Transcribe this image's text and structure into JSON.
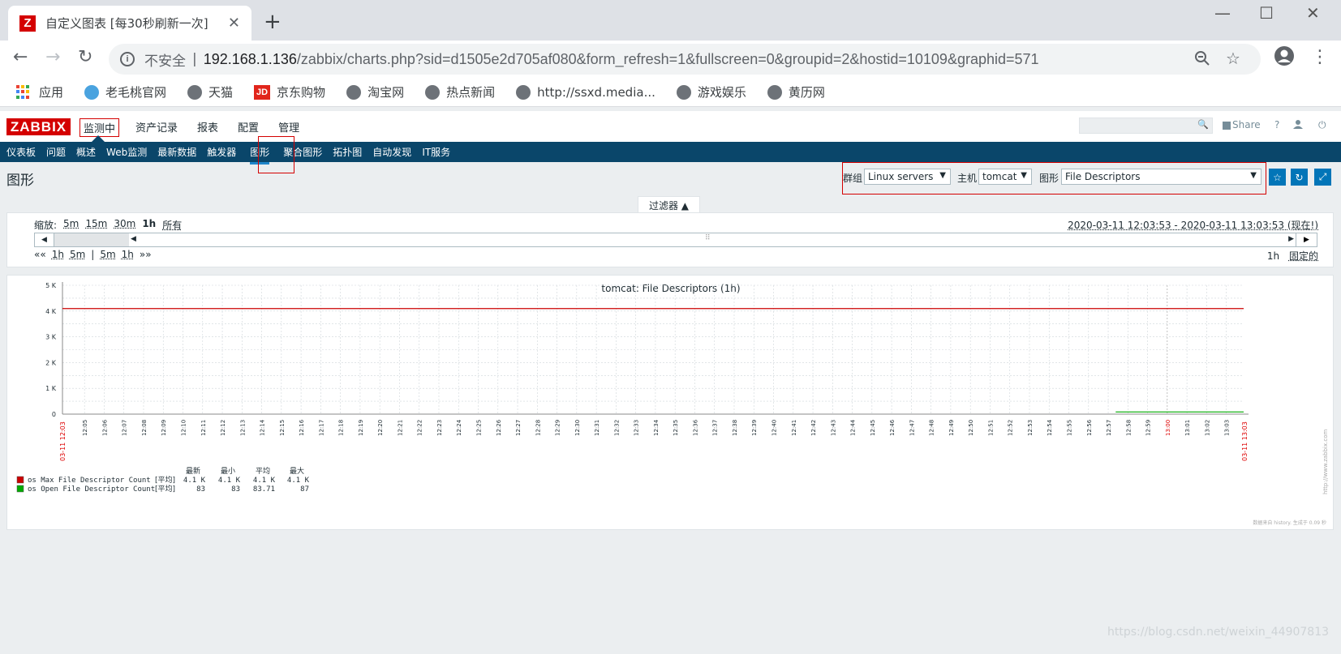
{
  "browser": {
    "tab_title": "自定义图表 [每30秒刷新一次]",
    "tab_favicon": "Z",
    "insecure_label": "不安全",
    "url_host": "192.168.1.136",
    "url_path": "/zabbix/charts.php?sid=d1505e2d705af080&form_refresh=1&fullscreen=0&groupid=2&hostid=10109&graphid=571",
    "bookmarks": [
      "应用",
      "老毛桃官网",
      "天猫",
      "京东购物",
      "淘宝网",
      "热点新闻",
      "http://ssxd.media...",
      "游戏娱乐",
      "黄历网"
    ],
    "jd_badge": "JD"
  },
  "zabbix": {
    "logo": "ZABBIX",
    "main_menu": [
      "监测中",
      "资产记录",
      "报表",
      "配置",
      "管理"
    ],
    "share_label": "Share",
    "help_label": "?",
    "sub_menu": [
      "仪表板",
      "问题",
      "概述",
      "Web监测",
      "最新数据",
      "触发器",
      "图形",
      "聚合图形",
      "拓扑图",
      "自动发现",
      "IT服务"
    ],
    "page_title": "图形",
    "group_label": "群组",
    "group_value": "Linux servers",
    "host_label": "主机",
    "host_value": "tomcat",
    "graph_label": "图形",
    "graph_value": "File Descriptors",
    "filter_tab": "过滤器 ▲",
    "zoom_label": "缩放:",
    "zoom_options": [
      "5m",
      "15m",
      "30m",
      "1h",
      "所有"
    ],
    "time_range": "2020-03-11 12:03:53 - 2020-03-11 13:03:53 (现在!)",
    "nav_back": "««",
    "nav_items": [
      "1h",
      "5m",
      "|",
      "5m",
      "1h"
    ],
    "nav_fwd": "»»",
    "period_value": "1h",
    "fixed_label": "固定的"
  },
  "chart_data": {
    "type": "line",
    "title": "tomcat: File Descriptors (1h)",
    "x_start_label": "03-11 12:03",
    "x_end_label": "03-11 13:03",
    "x_ticks": [
      "12:05",
      "12:06",
      "12:07",
      "12:08",
      "12:09",
      "12:10",
      "12:11",
      "12:12",
      "12:13",
      "12:14",
      "12:15",
      "12:16",
      "12:17",
      "12:18",
      "12:19",
      "12:20",
      "12:21",
      "12:22",
      "12:23",
      "12:24",
      "12:25",
      "12:26",
      "12:27",
      "12:28",
      "12:29",
      "12:30",
      "12:31",
      "12:32",
      "12:33",
      "12:34",
      "12:35",
      "12:36",
      "12:37",
      "12:38",
      "12:39",
      "12:40",
      "12:41",
      "12:42",
      "12:43",
      "12:44",
      "12:45",
      "12:46",
      "12:47",
      "12:48",
      "12:49",
      "12:50",
      "12:51",
      "12:52",
      "12:53",
      "12:54",
      "12:55",
      "12:56",
      "12:57",
      "12:58",
      "12:59",
      "13:00",
      "13:01",
      "13:02",
      "13:03"
    ],
    "y_ticks": [
      "0",
      "1 K",
      "2 K",
      "3 K",
      "4 K",
      "5 K"
    ],
    "ylim": [
      0,
      5000
    ],
    "grid": true,
    "series": [
      {
        "name": "os Max File Descriptor Count",
        "color": "#cc0000",
        "x_start_min": 0,
        "x_end_min": 60,
        "value": 4096
      },
      {
        "name": "os Open File Descriptor Count",
        "color": "#00aa00",
        "x_start_min": 53.5,
        "x_end_min": 60,
        "value": 84
      }
    ],
    "legend_unit": "[平均]",
    "legend_header": [
      "最新",
      "最小",
      "平均",
      "最大"
    ],
    "legend_rows": [
      [
        "4.1 K",
        "4.1 K",
        "4.1 K",
        "4.1 K"
      ],
      [
        "83",
        "83",
        "83.71",
        "87"
      ]
    ],
    "side_url": "http://www.zabbix.com",
    "footer_note": "数据来自 history. 生成于 0.09 秒"
  },
  "watermark": "https://blog.csdn.net/weixin_44907813"
}
